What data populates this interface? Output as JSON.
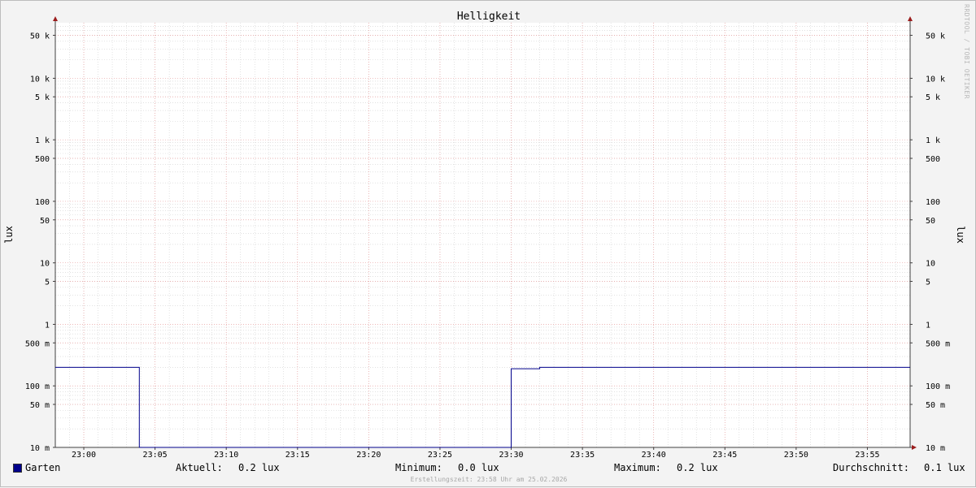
{
  "chart_data": {
    "type": "line",
    "title": "Helligkeit",
    "ylabel_left": "lux",
    "ylabel_right": "lux",
    "y_scale": "log",
    "ylim": [
      0.01,
      80000
    ],
    "y_ticks": [
      {
        "value": 50000,
        "label": "50 k"
      },
      {
        "value": 10000,
        "label": "10 k"
      },
      {
        "value": 5000,
        "label": "5 k"
      },
      {
        "value": 1000,
        "label": "1 k"
      },
      {
        "value": 500,
        "label": "500"
      },
      {
        "value": 100,
        "label": "100"
      },
      {
        "value": 50,
        "label": "50"
      },
      {
        "value": 10,
        "label": "10"
      },
      {
        "value": 5,
        "label": "5"
      },
      {
        "value": 1,
        "label": "1"
      },
      {
        "value": 0.5,
        "label": "500 m"
      },
      {
        "value": 0.1,
        "label": "100 m"
      },
      {
        "value": 0.05,
        "label": "50 m"
      },
      {
        "value": 0.01,
        "label": "10 m"
      }
    ],
    "x_range": [
      "22:58",
      "23:58"
    ],
    "x_ticks": [
      "23:00",
      "23:05",
      "23:10",
      "23:15",
      "23:20",
      "23:25",
      "23:30",
      "23:35",
      "23:40",
      "23:45",
      "23:50",
      "23:55"
    ],
    "series": [
      {
        "name": "Garten",
        "color": "#00008b",
        "points": [
          [
            "22:58",
            0.2
          ],
          [
            "23:03.9",
            0.2
          ],
          [
            "23:03.9",
            0.01
          ],
          [
            "23:04",
            0.01
          ],
          [
            "23:30",
            0.01
          ],
          [
            "23:30",
            0.19
          ],
          [
            "23:32",
            0.19
          ],
          [
            "23:32",
            0.2
          ],
          [
            "23:58",
            0.2
          ]
        ]
      }
    ],
    "grid": true
  },
  "legend": {
    "series_name": "Garten",
    "current_label": "Aktuell:",
    "current_value": "0.2 lux",
    "min_label": "Minimum:",
    "min_value": "0.0 lux",
    "max_label": "Maximum:",
    "max_value": "0.2 lux",
    "avg_label": "Durchschnitt:",
    "avg_value": "0.1 lux"
  },
  "footer": "Erstellungszeit: 23:58 Uhr am 25.02.2026",
  "watermark": "RRDTOOL / TOBI OETIKER",
  "colors": {
    "line": "#00008b",
    "grid_major": "#e8a0a0",
    "grid_minor": "#d0d0d0",
    "axis": "#404040",
    "arrow": "#9b1c1c"
  }
}
